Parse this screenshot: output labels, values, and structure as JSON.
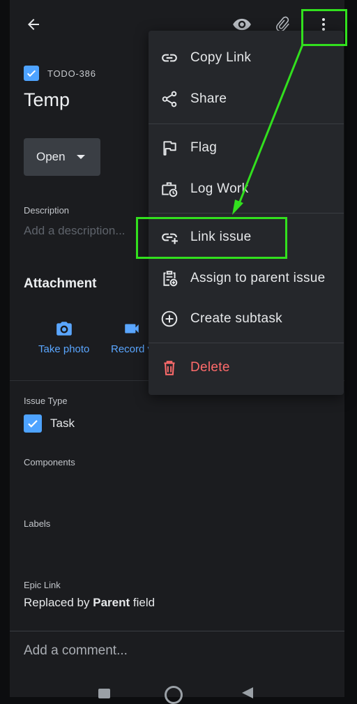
{
  "issue": {
    "key": "TODO-386",
    "title": "Temp",
    "status": "Open"
  },
  "description": {
    "label": "Description",
    "placeholder": "Add a description..."
  },
  "attachment": {
    "title": "Attachment",
    "take_photo": "Take photo",
    "record": "Record v"
  },
  "issue_type": {
    "label": "Issue Type",
    "value": "Task"
  },
  "components": {
    "label": "Components"
  },
  "labels": {
    "label": "Labels"
  },
  "epic_link": {
    "label": "Epic Link",
    "prefix": "Replaced by ",
    "bold": "Parent",
    "suffix": " field"
  },
  "comment": {
    "placeholder": "Add a comment..."
  },
  "menu": {
    "items": [
      {
        "label": "Copy Link",
        "icon": "link-icon"
      },
      {
        "label": "Share",
        "icon": "share-icon"
      },
      {
        "label": "Flag",
        "icon": "flag-icon"
      },
      {
        "label": "Log Work",
        "icon": "log-work-icon"
      },
      {
        "label": "Link issue",
        "icon": "add-link-icon"
      },
      {
        "label": "Assign to parent issue",
        "icon": "clipboard-add-icon"
      },
      {
        "label": "Create subtask",
        "icon": "plus-circle-icon"
      },
      {
        "label": "Delete",
        "icon": "trash-icon"
      }
    ]
  },
  "colors": {
    "accent": "#4ea3ff",
    "danger": "#ff6b6b",
    "highlight": "#32e01e"
  }
}
